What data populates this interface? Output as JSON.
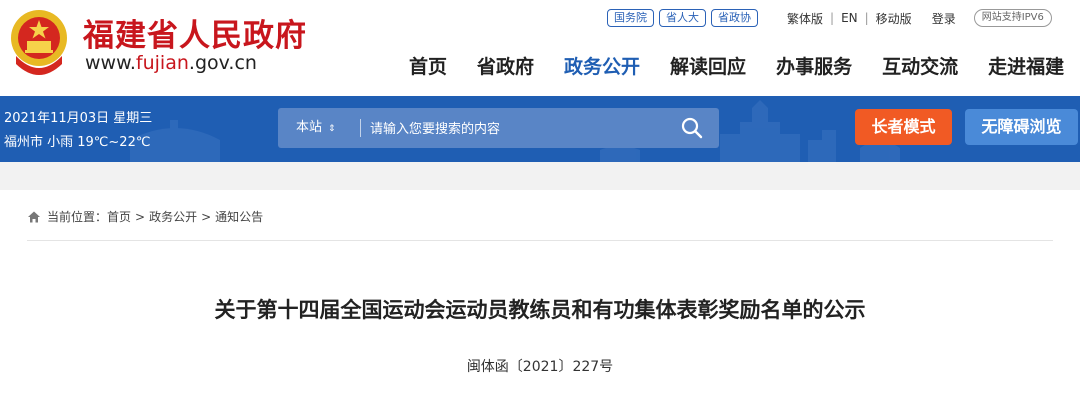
{
  "header": {
    "site_title": "福建省人民政府",
    "site_url_prefix": "www.",
    "site_url_highlight": "fujian",
    "site_url_suffix": ".gov.cn",
    "quick_links": [
      "国务院",
      "省人大",
      "省政协"
    ],
    "top_links": {
      "traditional": "繁体版",
      "english": "EN",
      "mobile": "移动版",
      "login": "登录",
      "ipv6": "网站支持IPV6"
    },
    "nav": [
      {
        "label": "首页",
        "active": false
      },
      {
        "label": "省政府",
        "active": false
      },
      {
        "label": "政务公开",
        "active": true
      },
      {
        "label": "解读回应",
        "active": false
      },
      {
        "label": "办事服务",
        "active": false
      },
      {
        "label": "互动交流",
        "active": false
      },
      {
        "label": "走进福建",
        "active": false
      }
    ]
  },
  "banner": {
    "date": "2021年11月03日 星期三",
    "weather": "福州市 小雨 19℃~22℃",
    "search_scope": "本站",
    "search_placeholder": "请输入您要搜索的内容",
    "elder_mode": "长者模式",
    "accessibility": "无障碍浏览"
  },
  "breadcrumb": {
    "prefix": "当前位置：",
    "items": [
      "首页",
      "政务公开",
      "通知公告"
    ],
    "separator": ">"
  },
  "document": {
    "title": "关于第十四届全国运动会运动员教练员和有功集体表彰奖励名单的公示",
    "number": "闽体函〔2021〕227号"
  },
  "colors": {
    "brand_red": "#c8161d",
    "brand_blue": "#1f5eb3",
    "elder_orange": "#f15a24",
    "access_blue": "#4a8ad8"
  }
}
